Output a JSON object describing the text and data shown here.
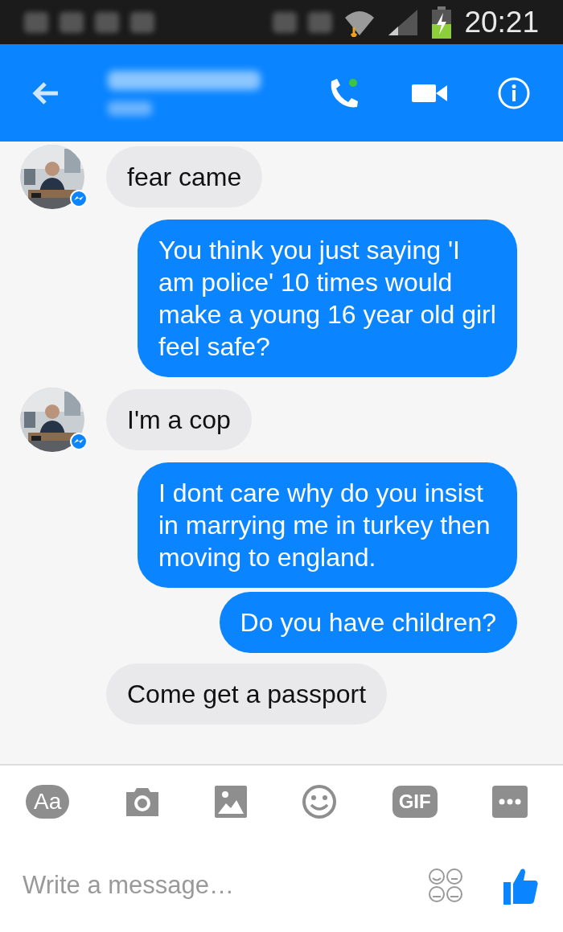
{
  "status_bar": {
    "time": "20:21"
  },
  "messages": [
    {
      "kind": "incoming",
      "text": "fear came"
    },
    {
      "kind": "outgoing",
      "text": "You think you just saying 'I am police' 10 times would make a young 16 year old girl feel safe?"
    },
    {
      "kind": "incoming",
      "text": "I'm a cop"
    },
    {
      "kind": "outgoing",
      "text": "I dont care why do you insist in marrying me in turkey then moving to england."
    },
    {
      "kind": "outgoing",
      "text": "Do you have children?"
    },
    {
      "kind": "incoming",
      "text": "Come get a passport"
    }
  ],
  "toolbar": {
    "text_button": "Aa",
    "gif_button": "GIF"
  },
  "composer": {
    "placeholder": "Write a message…"
  }
}
